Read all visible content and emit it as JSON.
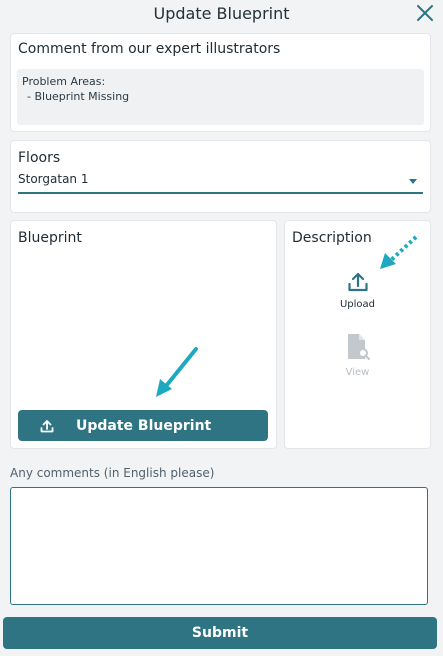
{
  "header": {
    "title": "Update Blueprint",
    "close_icon": "close-icon"
  },
  "comment_card": {
    "title": "Comment from our expert illustrators",
    "problem_title": "Problem Areas:",
    "problem_items": [
      "- Blueprint Missing"
    ]
  },
  "floors_card": {
    "title": "Floors",
    "selected": "Storgatan 1"
  },
  "blueprint_card": {
    "title": "Blueprint",
    "update_button_label": "Update Blueprint",
    "update_button_icon": "upload-icon"
  },
  "description_card": {
    "title": "Description",
    "upload_label": "Upload",
    "upload_icon": "upload-icon",
    "view_label": "View",
    "view_icon": "file-view-icon"
  },
  "comments": {
    "label": "Any comments (in English please)",
    "value": ""
  },
  "submit_label": "Submit",
  "colors": {
    "primary": "#2e7483",
    "hint_arrow": "#1fa9c0",
    "background": "#f1f3f5",
    "disabled": "#c3c8cc"
  }
}
